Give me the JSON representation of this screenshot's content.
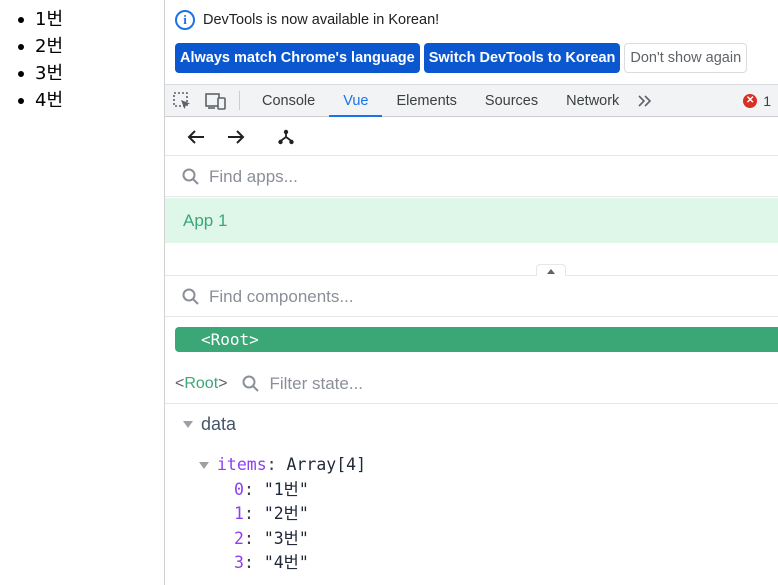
{
  "page": {
    "list_items": [
      "1번",
      "2번",
      "3번",
      "4번"
    ]
  },
  "infobar": {
    "message": "DevTools is now available in Korean!",
    "btn_match": "Always match Chrome's language",
    "btn_switch": "Switch DevTools to Korean",
    "btn_dismiss": "Don't show again"
  },
  "toolbar": {
    "tabs": [
      "Console",
      "Vue",
      "Elements",
      "Sources",
      "Network"
    ],
    "active_tab": "Vue",
    "error_count": "1"
  },
  "vue": {
    "find_apps_placeholder": "Find apps...",
    "app_name": "App 1",
    "find_components_placeholder": "Find components...",
    "root_component": "<Root>",
    "breadcrumb_open": "<",
    "breadcrumb_name": "Root",
    "breadcrumb_close": ">",
    "filter_state_placeholder": "Filter state...",
    "section_label": "data",
    "state_key": "items",
    "state_summary": "Array[4]",
    "array_entries": [
      {
        "index": "0",
        "value": "\"1번\""
      },
      {
        "index": "1",
        "value": "\"2번\""
      },
      {
        "index": "2",
        "value": "\"3번\""
      },
      {
        "index": "3",
        "value": "\"4번\""
      }
    ]
  },
  "colors": {
    "accent": "#1a73e8",
    "vue_green": "#3ba776",
    "app_highlight": "#dff7e9",
    "key_purple": "#8e3ff0"
  }
}
